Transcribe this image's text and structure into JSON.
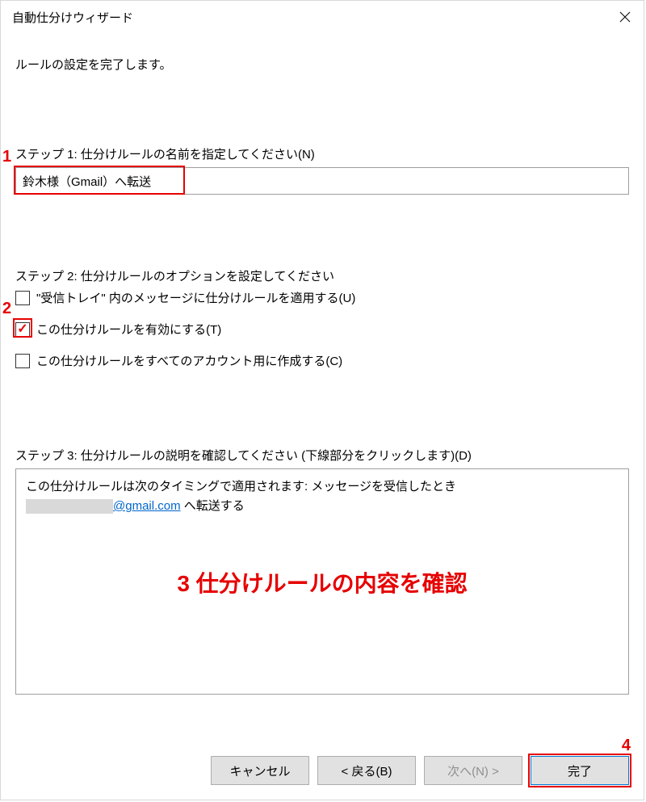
{
  "titlebar": {
    "title": "自動仕分けウィザード"
  },
  "heading": "ルールの設定を完了します。",
  "step1": {
    "label": "ステップ 1: 仕分けルールの名前を指定してください(N)",
    "value": "鈴木様（Gmail）へ転送"
  },
  "step2": {
    "label": "ステップ 2: 仕分けルールのオプションを設定してください",
    "options": [
      {
        "label": "\"受信トレイ\" 内のメッセージに仕分けルールを適用する(U)",
        "checked": false
      },
      {
        "label": "この仕分けルールを有効にする(T)",
        "checked": true
      },
      {
        "label": "この仕分けルールをすべてのアカウント用に作成する(C)",
        "checked": false
      }
    ]
  },
  "step3": {
    "label": "ステップ 3: 仕分けルールの説明を確認してください (下線部分をクリックします)(D)",
    "line1": "この仕分けルールは次のタイミングで適用されます: メッセージを受信したとき",
    "email": "@gmail.com",
    "suffix": " へ転送する"
  },
  "annotations": {
    "n1": "1",
    "n2": "2",
    "n3": "3 仕分けルールの内容を確認",
    "n4": "4"
  },
  "buttons": {
    "cancel": "キャンセル",
    "back": "< 戻る(B)",
    "next": "次へ(N) >",
    "finish": "完了"
  }
}
